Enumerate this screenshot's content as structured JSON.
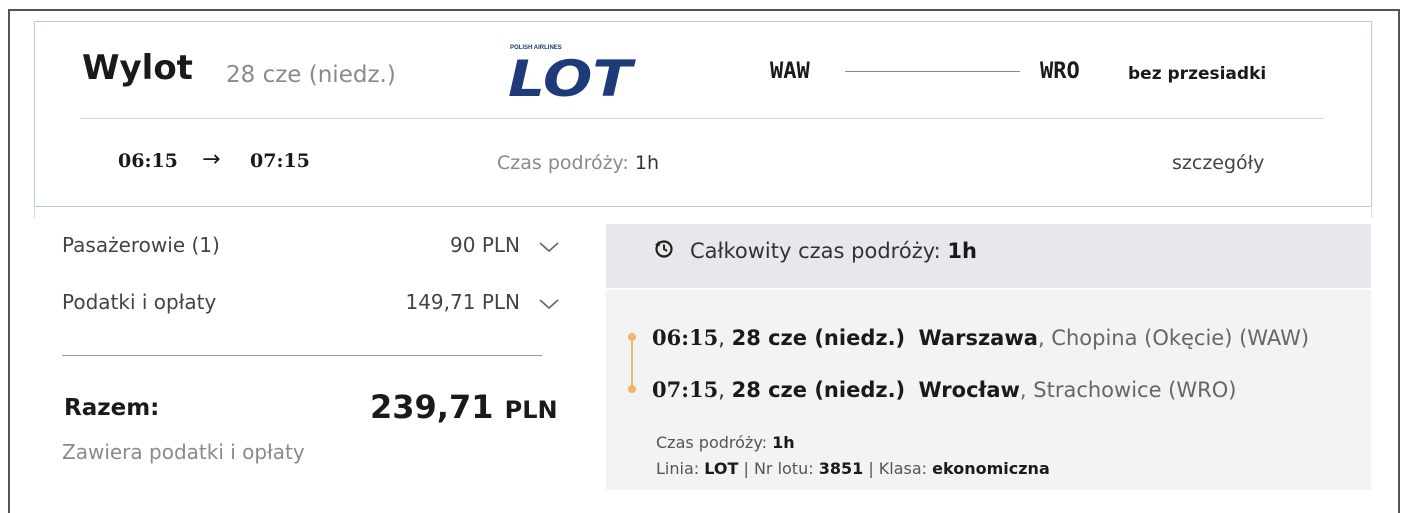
{
  "header": {
    "title": "Wylot",
    "date": "28 cze (niedz.)",
    "airline_logo": {
      "top_text": "POLISH AIRLINES",
      "main_text": "LOT",
      "color": "#1e3a78"
    },
    "from_iata": "WAW",
    "to_iata": "WRO",
    "stops": "bez przesiadki",
    "departure_time": "06:15",
    "arrival_time": "07:15",
    "arrow": "→",
    "duration_label": "Czas podróży: ",
    "duration_value": "1h",
    "details_link": "szczegóły"
  },
  "price": {
    "rows": [
      {
        "label": "Pasażerowie (1)",
        "value": "90 PLN"
      },
      {
        "label": "Podatki i opłaty",
        "value": "149,71 PLN"
      }
    ],
    "total_label": "Razem:",
    "total_amount": "239,71",
    "total_currency": "PLN",
    "includes_note": "Zawiera podatki i opłaty"
  },
  "itinerary": {
    "total_time_label": "Całkowity czas podróży: ",
    "total_time_value": "1h",
    "segments": [
      {
        "time": "06:15",
        "sep": ",",
        "date": "28 cze (niedz.)",
        "city": "Warszawa",
        "airport": ", Chopina (Okęcie) (WAW)"
      },
      {
        "time": "07:15",
        "sep": ",",
        "date": "28 cze (niedz.)",
        "city": "Wrocław",
        "airport": ", Strachowice (WRO)"
      }
    ],
    "info": {
      "duration_label": "Czas podróży: ",
      "duration_value": "1h",
      "line_label": "Linia: ",
      "line_value": "LOT",
      "flight_label": " | Nr lotu: ",
      "flight_value": "3851",
      "class_label": " | Klasa: ",
      "class_value": "ekonomiczna"
    },
    "accent_color": "#f0b567"
  }
}
